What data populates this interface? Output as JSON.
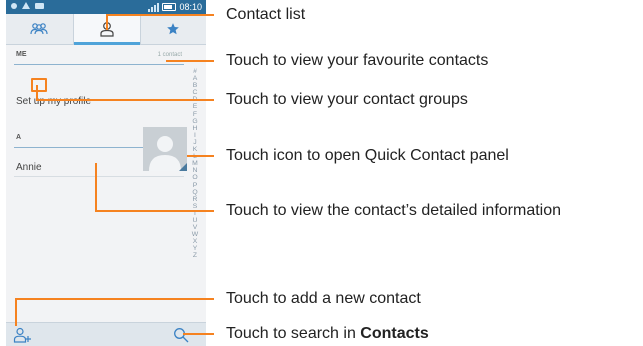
{
  "statusbar": {
    "time": "08:10"
  },
  "tabs": [
    {
      "name": "groups",
      "icon": "groups-icon"
    },
    {
      "name": "contacts",
      "icon": "person-icon"
    },
    {
      "name": "favourites",
      "icon": "star-icon"
    }
  ],
  "list": {
    "me_header": "ME",
    "me_count": "1 contact",
    "profile_row": "Set up my profile",
    "a_header": "A",
    "contact_name": "Annie"
  },
  "index_letters": [
    "#",
    "A",
    "B",
    "C",
    "D",
    "E",
    "F",
    "G",
    "H",
    "I",
    "J",
    "K",
    "L",
    "M",
    "N",
    "O",
    "P",
    "Q",
    "R",
    "S",
    "T",
    "U",
    "V",
    "W",
    "X",
    "Y",
    "Z"
  ],
  "bottom": {
    "add_icon": "add-contact-icon",
    "search_icon": "search-icon"
  },
  "callouts": {
    "contact_list": "Contact list",
    "favourites": "Touch to view your favourite contacts",
    "groups": "Touch to view your contact groups",
    "quick_contact": "Touch icon to open Quick Contact panel",
    "detail": "Touch to view the contact’s detailed information",
    "add": "Touch to add a new contact",
    "search_prefix": "Touch to search in ",
    "search_bold": "Contacts"
  },
  "colors": {
    "accent": "#f58220",
    "statusbar": "#2a6c9a",
    "tab_indicator": "#4fa3d9"
  }
}
